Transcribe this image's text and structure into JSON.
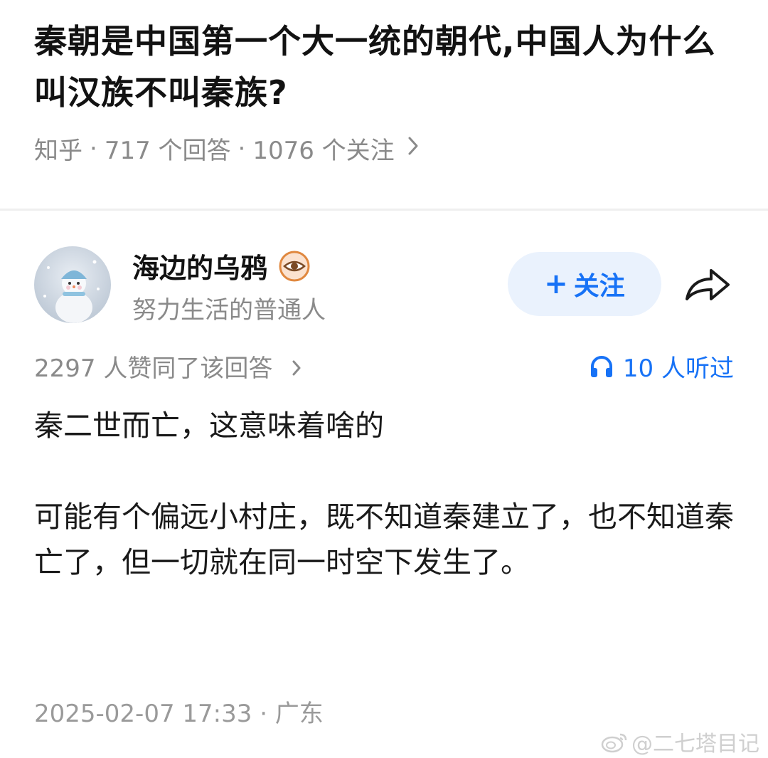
{
  "question": {
    "title": "秦朝是中国第一个大一统的朝代,中国人为什么叫汉族不叫秦族?",
    "source": "知乎",
    "answers": "717 个回答",
    "followers": "1076 个关注"
  },
  "author": {
    "name": "海边的乌鸦",
    "bio": "努力生活的普通人",
    "follow_label": "关注"
  },
  "stats": {
    "votes": "2297 人赞同了该回答",
    "listens": "10 人听过"
  },
  "content": {
    "para1": "秦二世而亡，这意味着啥的",
    "para2": "可能有个偏远小村庄，既不知道秦建立了，也不知道秦亡了，但一切就在同一时空下发生了。"
  },
  "footer": {
    "timestamp": "2025-02-07 17:33 · 广东"
  },
  "watermark": {
    "text": "@二七塔目记"
  },
  "colors": {
    "accent": "#1772f6",
    "follow_bg": "#eaf2fd",
    "meta_text": "#8a8a8a"
  },
  "icons": {
    "badge": "eye-badge-icon",
    "share": "share-arrow-icon",
    "listen": "headphones-icon",
    "chevron": "chevron-right-icon"
  }
}
